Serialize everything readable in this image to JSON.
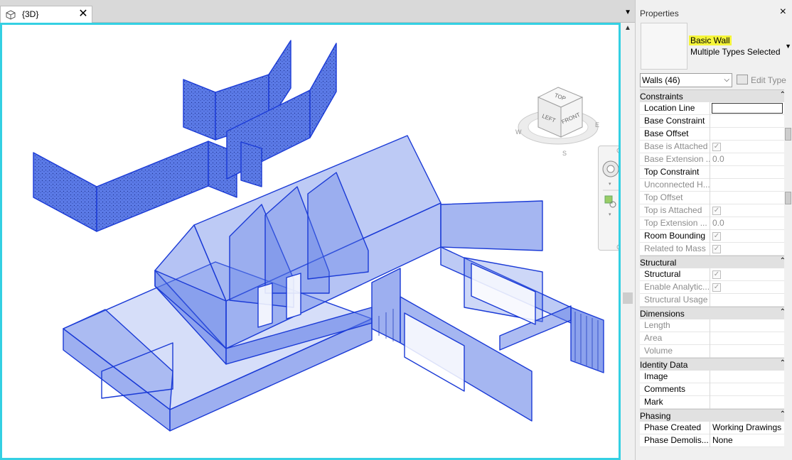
{
  "view_tab": {
    "label": "{3D}",
    "close_icon": "close-icon",
    "icon": "3d-view-icon"
  },
  "viewcube": {
    "top": "TOP",
    "left": "LEFT",
    "front": "FRONT",
    "compass_w": "W",
    "compass_s": "S",
    "compass_e": "E"
  },
  "properties": {
    "title": "Properties",
    "close": "×",
    "type_family": "Basic Wall",
    "type_name": "Multiple Types Selected",
    "filter": "Walls (46)",
    "edit_type": "Edit Type",
    "groups": [
      {
        "label": "Constraints",
        "rows": [
          {
            "name": "Location Line",
            "value": "",
            "kind": "input"
          },
          {
            "name": "Base Constraint",
            "value": ""
          },
          {
            "name": "Base Offset",
            "value": ""
          },
          {
            "name": "Base is Attached",
            "value": "",
            "kind": "check",
            "disabled": true
          },
          {
            "name": "Base Extension ...",
            "value": "0.0",
            "disabled": true
          },
          {
            "name": "Top Constraint",
            "value": ""
          },
          {
            "name": "Unconnected H...",
            "value": "",
            "disabled": true
          },
          {
            "name": "Top Offset",
            "value": "",
            "disabled": true
          },
          {
            "name": "Top is Attached",
            "value": "",
            "kind": "check",
            "disabled": true
          },
          {
            "name": "Top Extension ...",
            "value": "0.0",
            "disabled": true
          },
          {
            "name": "Room Bounding",
            "value": "",
            "kind": "check"
          },
          {
            "name": "Related to Mass",
            "value": "",
            "kind": "check",
            "disabled": true
          }
        ]
      },
      {
        "label": "Structural",
        "rows": [
          {
            "name": "Structural",
            "value": "",
            "kind": "check"
          },
          {
            "name": "Enable Analytic...",
            "value": "",
            "kind": "check",
            "disabled": true
          },
          {
            "name": "Structural Usage",
            "value": "",
            "disabled": true
          }
        ]
      },
      {
        "label": "Dimensions",
        "rows": [
          {
            "name": "Length",
            "value": "",
            "disabled": true
          },
          {
            "name": "Area",
            "value": "",
            "disabled": true
          },
          {
            "name": "Volume",
            "value": "",
            "disabled": true
          }
        ]
      },
      {
        "label": "Identity Data",
        "rows": [
          {
            "name": "Image",
            "value": ""
          },
          {
            "name": "Comments",
            "value": ""
          },
          {
            "name": "Mark",
            "value": ""
          }
        ]
      },
      {
        "label": "Phasing",
        "rows": [
          {
            "name": "Phase Created",
            "value": "Working Drawings"
          },
          {
            "name": "Phase Demolis...",
            "value": "None"
          }
        ]
      }
    ]
  },
  "colors": {
    "selection_blue": "#4f6fe3",
    "view_border": "#34d0e3",
    "highlight": "#f5f53a"
  }
}
